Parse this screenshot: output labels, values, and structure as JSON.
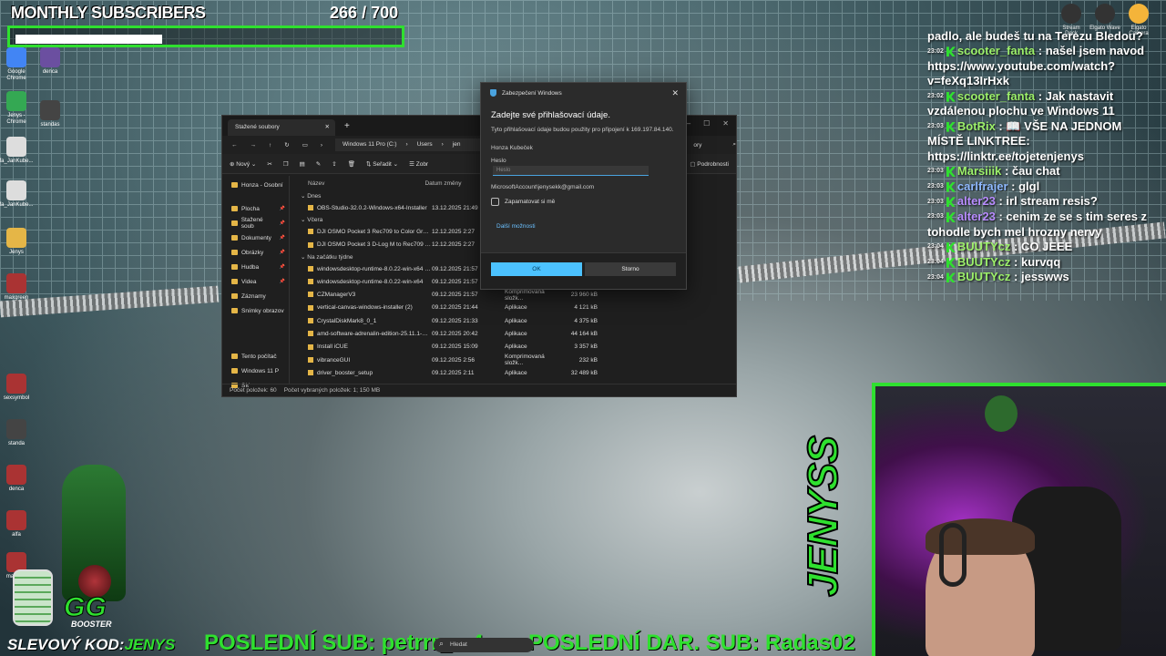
{
  "subscribers": {
    "title": "MONTHLY SUBSCRIBERS",
    "current": "266",
    "goal": "/ 700",
    "progress": 0.38
  },
  "desktop_icons": [
    {
      "label": "Google Chrome",
      "color": "#4285f4"
    },
    {
      "label": "denca",
      "color": "#6b4fa0"
    },
    {
      "label": "Jenys - Chrome",
      "color": "#34a853"
    },
    {
      "label": "standas",
      "color": "#444"
    },
    {
      "label": "fa_JanKube...",
      "color": "#ddd"
    },
    {
      "label": "fa_JanKube...",
      "color": "#ddd"
    },
    {
      "label": "Jenys",
      "color": "#e5b647"
    },
    {
      "label": "maxgreen",
      "color": "#a33"
    },
    {
      "label": "sexsymbol",
      "color": "#a33"
    },
    {
      "label": "standa",
      "color": "#444"
    },
    {
      "label": "denca",
      "color": "#a33"
    },
    {
      "label": "alfa",
      "color": "#a33"
    },
    {
      "label": "maxlook",
      "color": "#a33"
    }
  ],
  "tray_icons": [
    {
      "label": "Stream Deck",
      "icon": "stream-deck-icon"
    },
    {
      "label": "Elgato Wave",
      "icon": "wave-icon"
    },
    {
      "label": "Elgato Camera",
      "icon": "camera-icon"
    }
  ],
  "explorer": {
    "tab_title": "Stažené soubory",
    "crumbs": [
      "Windows 11 Pro (C:)",
      "Users",
      "jen"
    ],
    "search_placeholder": "ory",
    "toolbar": {
      "new": "Nový",
      "sort": "Seřadit",
      "view": "Zobr",
      "details": "Podrobnosti"
    },
    "sidebar": [
      {
        "label": "Honza - Osobní",
        "pinned": false
      },
      {
        "label": "Plocha",
        "pinned": true
      },
      {
        "label": "Stažené soub",
        "pinned": true
      },
      {
        "label": "Dokumenty",
        "pinned": true
      },
      {
        "label": "Obrázky",
        "pinned": true
      },
      {
        "label": "Hudba",
        "pinned": true
      },
      {
        "label": "Videa",
        "pinned": true
      },
      {
        "label": "Záznamy",
        "pinned": false
      },
      {
        "label": "Snímky obrazov",
        "pinned": false
      },
      {
        "label": "Tento počítač",
        "pinned": false
      },
      {
        "label": "Windows 11 P",
        "pinned": false
      },
      {
        "label": "Síť",
        "pinned": false
      }
    ],
    "columns": {
      "name": "Název",
      "date": "Datum změny"
    },
    "groups": [
      {
        "label": "Dnes",
        "rows": [
          {
            "name": "OBS-Studio-32.0.2-Windows-x64-Installer",
            "date": "13.12.2025 21:49",
            "type": "",
            "size": ""
          }
        ]
      },
      {
        "label": "Včera",
        "rows": [
          {
            "name": "DJI OSMO Pocket 3 Rec709 to Color Grading L...",
            "date": "12.12.2025 2:27",
            "type": "",
            "size": ""
          },
          {
            "name": "DJI OSMO Pocket 3 D-Log M to Rec709 V1.cube",
            "date": "12.12.2025 2:27",
            "type": "",
            "size": ""
          }
        ]
      },
      {
        "label": "Na začátku týdne",
        "rows": [
          {
            "name": "windowsdesktop-runtime-8.0.22-win-x64 (1)",
            "date": "09.12.2025 21:57",
            "type": "",
            "size": ""
          },
          {
            "name": "windowsdesktop-runtime-8.0.22-win-x64",
            "date": "09.12.2025 21:57",
            "type": "",
            "size": ""
          },
          {
            "name": "CZManagerV3",
            "date": "09.12.2025 21:57",
            "type": "Komprimovaná složk...",
            "size": "23 960 kB"
          },
          {
            "name": "vertical-canvas-windows-installer (2)",
            "date": "09.12.2025 21:44",
            "type": "Aplikace",
            "size": "4 121 kB"
          },
          {
            "name": "CrystalDiskMark8_0_1",
            "date": "09.12.2025 21:33",
            "type": "Aplikace",
            "size": "4 375 kB"
          },
          {
            "name": "amd-software-adrenalin-edition-25.11.1-minim...",
            "date": "09.12.2025 20:42",
            "type": "Aplikace",
            "size": "44 164 kB"
          },
          {
            "name": "Install iCUE",
            "date": "09.12.2025 15:09",
            "type": "Aplikace",
            "size": "3 357 kB"
          },
          {
            "name": "vibranceGUI",
            "date": "09.12.2025 2:56",
            "type": "Komprimovaná složk...",
            "size": "232 kB"
          },
          {
            "name": "driver_booster_setup",
            "date": "09.12.2025 2:11",
            "type": "Aplikace",
            "size": "32 489 kB"
          }
        ]
      }
    ],
    "status": {
      "count": "Počet položek: 60",
      "selected": "Počet vybraných položek: 1; 150 MB"
    }
  },
  "dialog": {
    "window_title": "Zabezpečení Windows",
    "heading": "Zadejte své přihlašovací údaje.",
    "description": "Tyto přihlašovací údaje budou použity pro připojení k 169.197.84.140.",
    "username": "Honza Kubeček",
    "password_label": "Heslo",
    "password_placeholder": "Heslo",
    "account": "MicrosoftAccount\\jenysekk@gmail.com",
    "remember": "Zapamatovat si mě",
    "more_options": "Další možnosti",
    "ok": "OK",
    "cancel": "Storno"
  },
  "chat": [
    {
      "time": "",
      "user": "",
      "text": "padlo, ale budeš tu na Terezu Bledou?",
      "color": "green"
    },
    {
      "time": "23:02",
      "user": "scooter_fanta",
      "text": ": našel jsem navod https://www.youtube.com/watch?v=feXq13IrHxk",
      "color": "green"
    },
    {
      "time": "23:02",
      "user": "scooter_fanta",
      "text": ": Jak nastavit vzdálenou plochu ve Windows 11",
      "color": "green"
    },
    {
      "time": "23:03",
      "user": "BotRix",
      "text": ": 📖 VŠE NA JEDNOM MÍSTĚ LINKTREE: https://linktr.ee/tojetenjenys",
      "color": "green"
    },
    {
      "time": "23:03",
      "user": "Marsiiik",
      "text": ": čau chat",
      "color": "green"
    },
    {
      "time": "23:03",
      "user": "carlfrajer",
      "text": ": glgl",
      "color": "blue"
    },
    {
      "time": "23:03",
      "user": "alter23",
      "text": ": irl stream resis?",
      "color": "purple"
    },
    {
      "time": "23:03",
      "user": "alter23",
      "text": ": cenim ze se s tim seres z tohodle bych mel hrozny nervy",
      "color": "purple"
    },
    {
      "time": "23:04",
      "user": "BUUTYcz",
      "text": ": CO JEEE",
      "color": "green"
    },
    {
      "time": "23:04",
      "user": "BUUTYcz",
      "text": ": kurvqq",
      "color": "green"
    },
    {
      "time": "23:04",
      "user": "BUUTYcz",
      "text": ": jesswws",
      "color": "green"
    }
  ],
  "overlay": {
    "brand": "JENYSS",
    "promo_prefix": "SLEVOVÝ KOD:",
    "promo_code": "JENYS",
    "last_sub": "POSLEDNÍ SUB: petrrr_m4",
    "last_gift": "POSLEDNÍ DAR. SUB: Radas02",
    "booster_logo": "GG",
    "booster_label": "BOOSTER"
  },
  "taskbar": {
    "search_placeholder": "Hledat"
  },
  "colors": {
    "accent": "#2fe02f",
    "dialog_ok": "#4cc2ff",
    "folder": "#e5b647"
  }
}
